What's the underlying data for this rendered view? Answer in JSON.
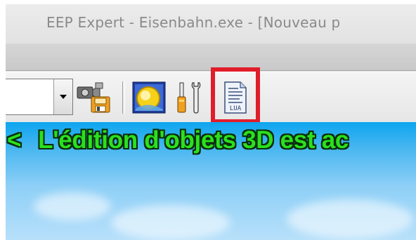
{
  "window": {
    "title": "EEP Expert - Eisenbahn.exe - [Nouveau p"
  },
  "toolbar": {
    "combo_value": "",
    "icons": [
      "camera-save-icon",
      "sun-weather-icon",
      "tools-icon",
      "lua-script-icon"
    ],
    "lua_icon_label": "LUA",
    "highlight_color": "#e11d2a"
  },
  "canvas": {
    "message_arrow": "<",
    "message": "L'édition d'objets 3D est ac",
    "message_color": "#2be01f"
  }
}
